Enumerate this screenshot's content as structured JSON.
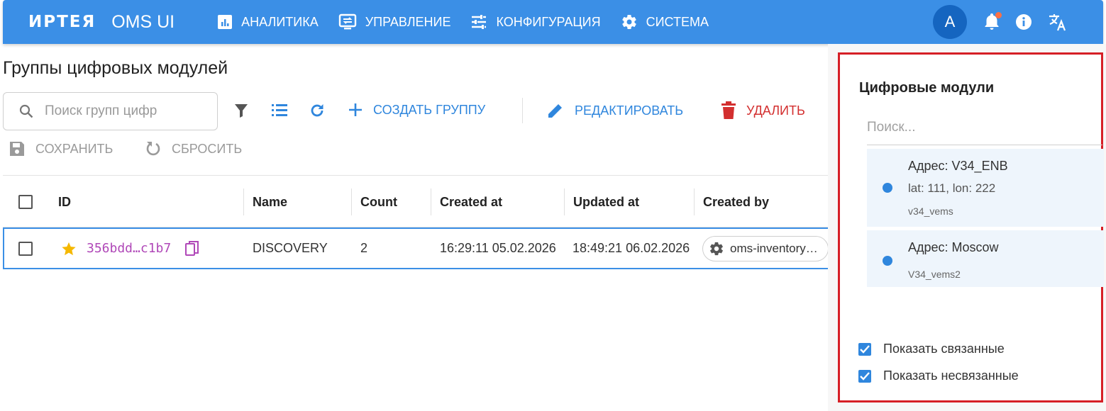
{
  "header": {
    "brand": "ИРТЕЯ",
    "app_name": "OMS UI",
    "nav": [
      {
        "label": "АНАЛИТИКА",
        "icon": "analytics-icon"
      },
      {
        "label": "УПРАВЛЕНИЕ",
        "icon": "management-icon"
      },
      {
        "label": "КОНФИГУРАЦИЯ",
        "icon": "tune-icon"
      },
      {
        "label": "СИСТЕМА",
        "icon": "gear-icon"
      }
    ],
    "avatar_letter": "A",
    "icons": [
      "bell-icon",
      "info-icon",
      "translate-icon"
    ]
  },
  "page": {
    "title": "Группы цифровых модулей",
    "search_placeholder": "Поиск групп цифр"
  },
  "toolbar": {
    "create_label": "СОЗДАТЬ ГРУППУ",
    "edit_label": "РЕДАКТИРОВАТЬ",
    "delete_label": "УДАЛИТЬ",
    "save_label": "СОХРАНИТЬ",
    "reset_label": "СБРОСИТЬ"
  },
  "table": {
    "columns": [
      "ID",
      "Name",
      "Count",
      "Created at",
      "Updated at",
      "Created by"
    ],
    "rows": [
      {
        "id": "356bdd…c1b7",
        "name": "DISCOVERY",
        "count": "2",
        "created_at": "16:29:11 05.02.2026",
        "updated_at": "18:49:21 06.02.2026",
        "created_by": "oms-inventory…"
      }
    ]
  },
  "panel": {
    "title": "Цифровые модули",
    "search_placeholder": "Поиск...",
    "items": [
      {
        "address": "Адрес: V34_ENB",
        "coords": "lat: 111, lon: 222",
        "name": "v34_vems"
      },
      {
        "address": "Адрес: Moscow",
        "name": "V34_vems2"
      }
    ],
    "show_linked": "Показать связанные",
    "show_unlinked": "Показать несвязанные"
  },
  "colors": {
    "primary": "#3b8fe6",
    "danger": "#d32f2f",
    "id_text": "#b048b8",
    "highlight_border": "#d61f26"
  }
}
